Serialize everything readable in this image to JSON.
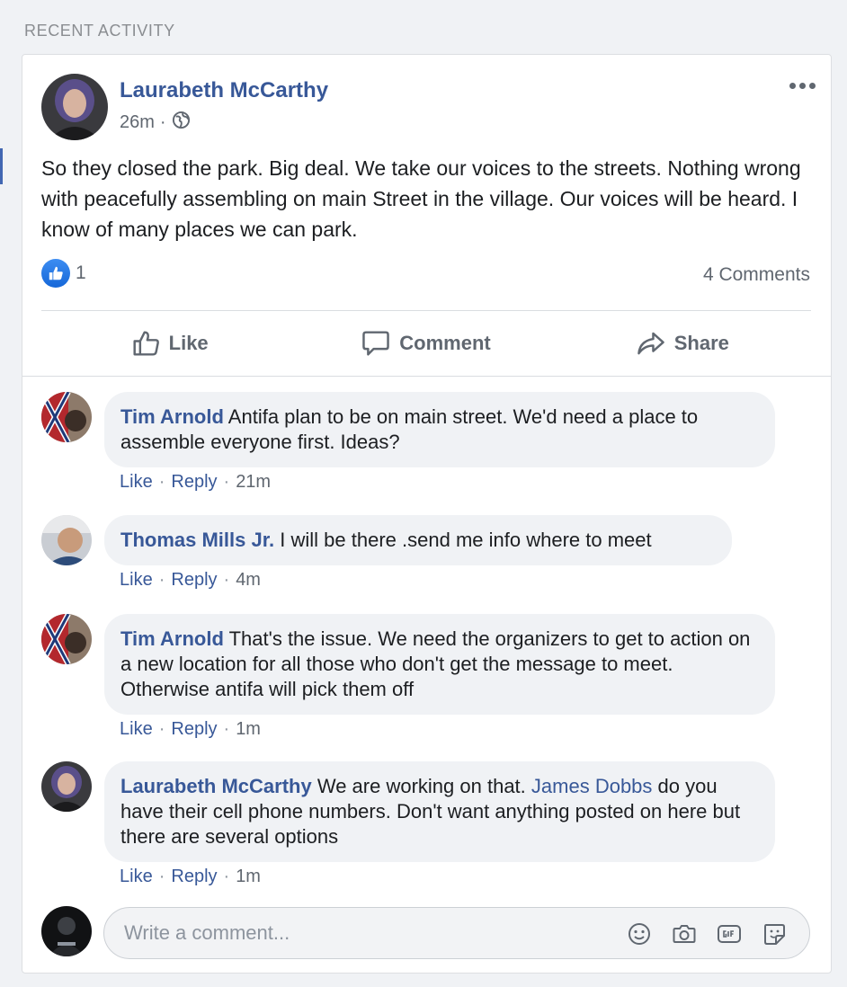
{
  "section_title": "RECENT ACTIVITY",
  "post": {
    "author": "Laurabeth McCarthy",
    "time": "26m",
    "meta_separator": "·",
    "privacy_icon": "globe-icon",
    "text": "So they closed the park. Big deal. We take our voices to the streets. Nothing wrong with peacefully assembling on main Street in the village. Our voices will be heard. I know of many places we can park.",
    "reaction_icon": "like-reaction-icon",
    "reaction_count": "1",
    "comments_count": "4 Comments",
    "actions": {
      "like": "Like",
      "comment": "Comment",
      "share": "Share"
    }
  },
  "comments": [
    {
      "author": "Tim Arnold",
      "text": "Antifa plan to be on main street. We'd need a place to assemble everyone first. Ideas?",
      "like": "Like",
      "reply": "Reply",
      "sep": "·",
      "time": "21m"
    },
    {
      "author": "Thomas Mills Jr.",
      "text": "I will be there .send me info where to meet",
      "like": "Like",
      "reply": "Reply",
      "sep": "·",
      "time": "4m"
    },
    {
      "author": "Tim Arnold",
      "text": "That's the issue. We need the organizers to get to action on a new location for all those who don't get the message to meet. Otherwise antifa will pick them off",
      "like": "Like",
      "reply": "Reply",
      "sep": "·",
      "time": "1m"
    },
    {
      "author": "Laurabeth McCarthy",
      "text_before_mention": "We are working on that.",
      "mention": "James Dobbs",
      "text_after_mention": "do you have their cell phone numbers. Don't want anything posted on here but there are several options",
      "like": "Like",
      "reply": "Reply",
      "sep": "·",
      "time": "1m"
    }
  ],
  "composer": {
    "placeholder": "Write a comment...",
    "icons": [
      "emoji-icon",
      "camera-icon",
      "gif-icon",
      "sticker-icon"
    ]
  },
  "colors": {
    "link_blue": "#385898",
    "accent_blue": "#1877f2",
    "background": "#f0f2f5"
  }
}
